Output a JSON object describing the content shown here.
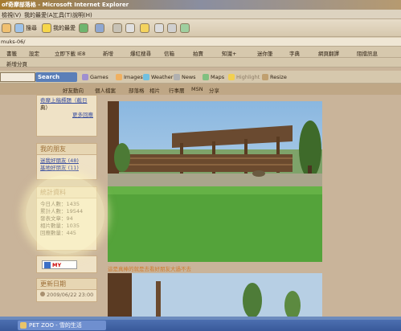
{
  "window": {
    "title": "of奇摩部落格 - Microsoft Internet Explorer"
  },
  "menu": {
    "items": [
      "檢視(V)",
      "我的最愛(A)",
      "工具(T)",
      "說明(H)"
    ]
  },
  "toolbar": {
    "search_label": "搜尋",
    "favorites_label": "我的最愛"
  },
  "address": {
    "url": "muks-06/"
  },
  "links": {
    "row1": [
      "書籤",
      "設定",
      "立即下載 IE8",
      "新增",
      "爆紅搜尋",
      "信箱",
      "拍賣",
      "知識+",
      "迷你筆",
      "字典",
      "網頁翻譯",
      "阻擋訊息"
    ],
    "row2": [
      "新增分頁"
    ]
  },
  "searchbar": {
    "button": "Search",
    "items": [
      "Games",
      "Images",
      "Weather",
      "News",
      "Maps",
      "Highlight",
      "Resize"
    ]
  },
  "blog_nav": [
    "好友動向",
    "個人檔案",
    "部落格",
    "相片",
    "行事曆",
    "MSN",
    "分享"
  ],
  "sidebar": {
    "widget_top": {
      "lines": [
        "奇摩上稿標題（截日",
        "典）"
      ],
      "more": "更多回應"
    },
    "friends": {
      "title": "我的朋友",
      "items": [
        "迷我好朋友 (48)",
        "基地好朋友 (11)"
      ]
    },
    "stats": {
      "title": "統計資料",
      "lines": [
        "今日人數：1435",
        "累計人數：19544",
        "發表文章：94",
        "相片數量：1035",
        "回應數量：445"
      ]
    },
    "badge": "MY",
    "updated": {
      "title": "更新日期",
      "value": "2009/06/22 23:00"
    }
  },
  "content": {
    "caption": "這是真棒的就是去看好朋友大過不去"
  },
  "taskbar": {
    "button": "PET ZOO - 雪的生活"
  }
}
